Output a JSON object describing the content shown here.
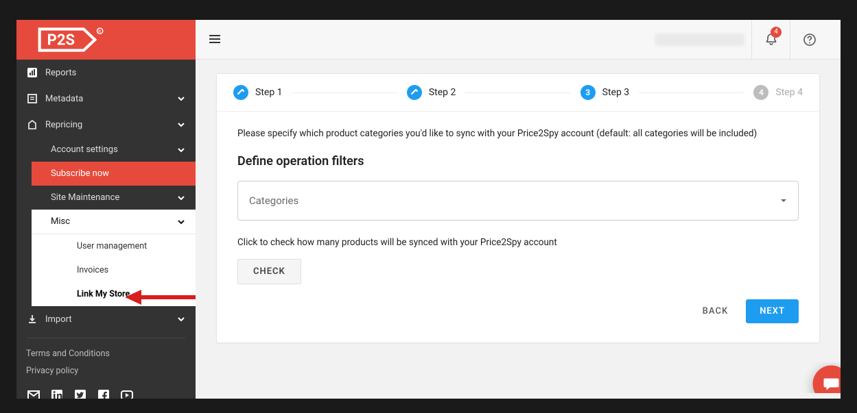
{
  "brand": {
    "name": "P2S"
  },
  "sidebar": {
    "reports": "Reports",
    "metadata": "Metadata",
    "repricing": "Repricing",
    "account_settings": "Account settings",
    "subscribe": "Subscribe now",
    "site_maintenance": "Site Maintenance",
    "misc": "Misc",
    "user_management": "User management",
    "invoices": "Invoices",
    "link_my_store": "Link My Store",
    "import": "Import",
    "terms": "Terms and Conditions",
    "privacy": "Privacy policy"
  },
  "topbar": {
    "notification_count": "4"
  },
  "stepper": {
    "step1": "Step 1",
    "step2": "Step 2",
    "step3": "Step 3",
    "step4": "Step 4",
    "current_number": "3",
    "pending_number": "4"
  },
  "content": {
    "intro": "Please specify which product categories you'd like to sync with your Price2Spy account (default: all categories will be included)",
    "section_title": "Define operation filters",
    "select_placeholder": "Categories",
    "hint": "Click to check how many products will be synced with your Price2Spy account",
    "check": "CHECK",
    "back": "BACK",
    "next": "NEXT"
  }
}
